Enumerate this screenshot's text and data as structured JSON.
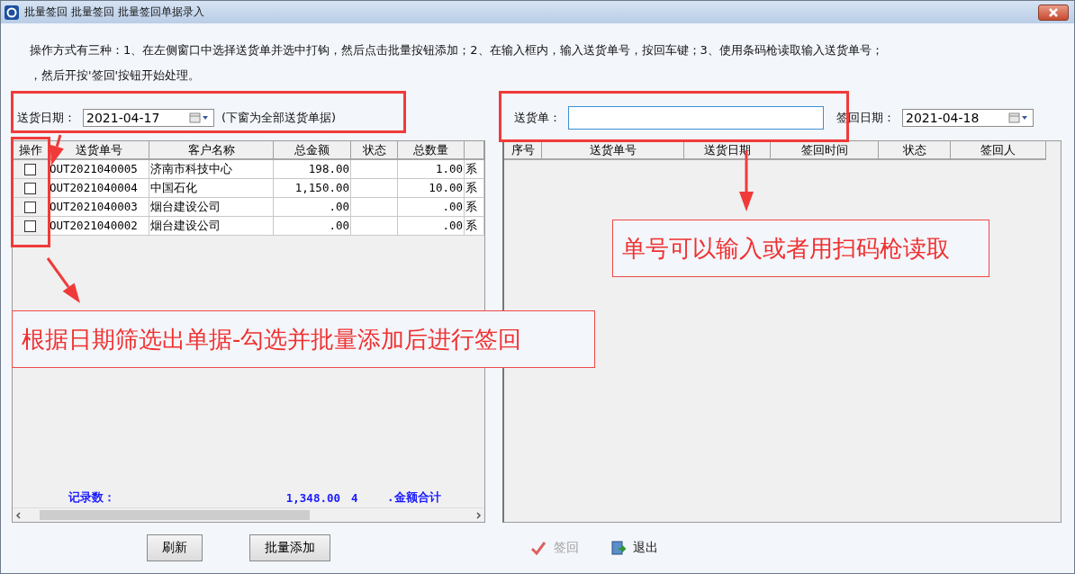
{
  "window": {
    "title": "批量签回 批量签回 批量签回单据录入"
  },
  "instructions": [
    "操作方式有三种：1、在左侧窗口中选择送货单并选中打钩，然后点击批量按钮添加；2、在输入框内，输入送货单号，按回车键；3、使用条码枪读取输入送货单号；",
    "，然后开按'签回'按钮开始处理。"
  ],
  "left_filter": {
    "label": "送货日期：",
    "date": "2021-04-17",
    "note": "(下窗为全部送货单据)"
  },
  "right_filter": {
    "label": "送货单：",
    "date_label": "签回日期：",
    "date": "2021-04-18"
  },
  "left_table": {
    "check_column": "操作",
    "columns": [
      "送货单号",
      "客户名称",
      "总金额",
      "状态",
      "总数量",
      ""
    ],
    "rows": [
      {
        "checked": false,
        "cells": [
          "OUT2021040005",
          "济南市科技中心",
          "198.00",
          "",
          "1.00",
          "系"
        ]
      },
      {
        "checked": false,
        "cells": [
          "OUT2021040004",
          "中国石化",
          "1,150.00",
          "",
          "10.00",
          "系"
        ]
      },
      {
        "checked": false,
        "cells": [
          "OUT2021040003",
          "烟台建设公司",
          ".00",
          "",
          ".00",
          "系"
        ]
      },
      {
        "checked": false,
        "cells": [
          "OUT2021040002",
          "烟台建设公司",
          ".00",
          "",
          ".00",
          "系"
        ]
      }
    ],
    "footer": [
      "记录数：",
      "1,348.00",
      "4",
      ".金额合计"
    ]
  },
  "right_table": {
    "columns": [
      "序号",
      "送货单号",
      "送货日期",
      "签回时间",
      "状态",
      "签回人"
    ]
  },
  "buttons": [
    {
      "label": "刷新",
      "kind": "plain",
      "disabled": false
    },
    {
      "label": "批量添加",
      "kind": "plain",
      "disabled": false
    },
    {
      "label": "签回",
      "kind": "check",
      "disabled": true
    },
    {
      "label": "退出",
      "kind": "exit",
      "disabled": false
    }
  ],
  "annotations": [
    {
      "text": "根据日期筛选出单据-勾选并批量添加后进行签回"
    },
    {
      "text": "单号可以输入或者用扫码枪读取"
    }
  ]
}
